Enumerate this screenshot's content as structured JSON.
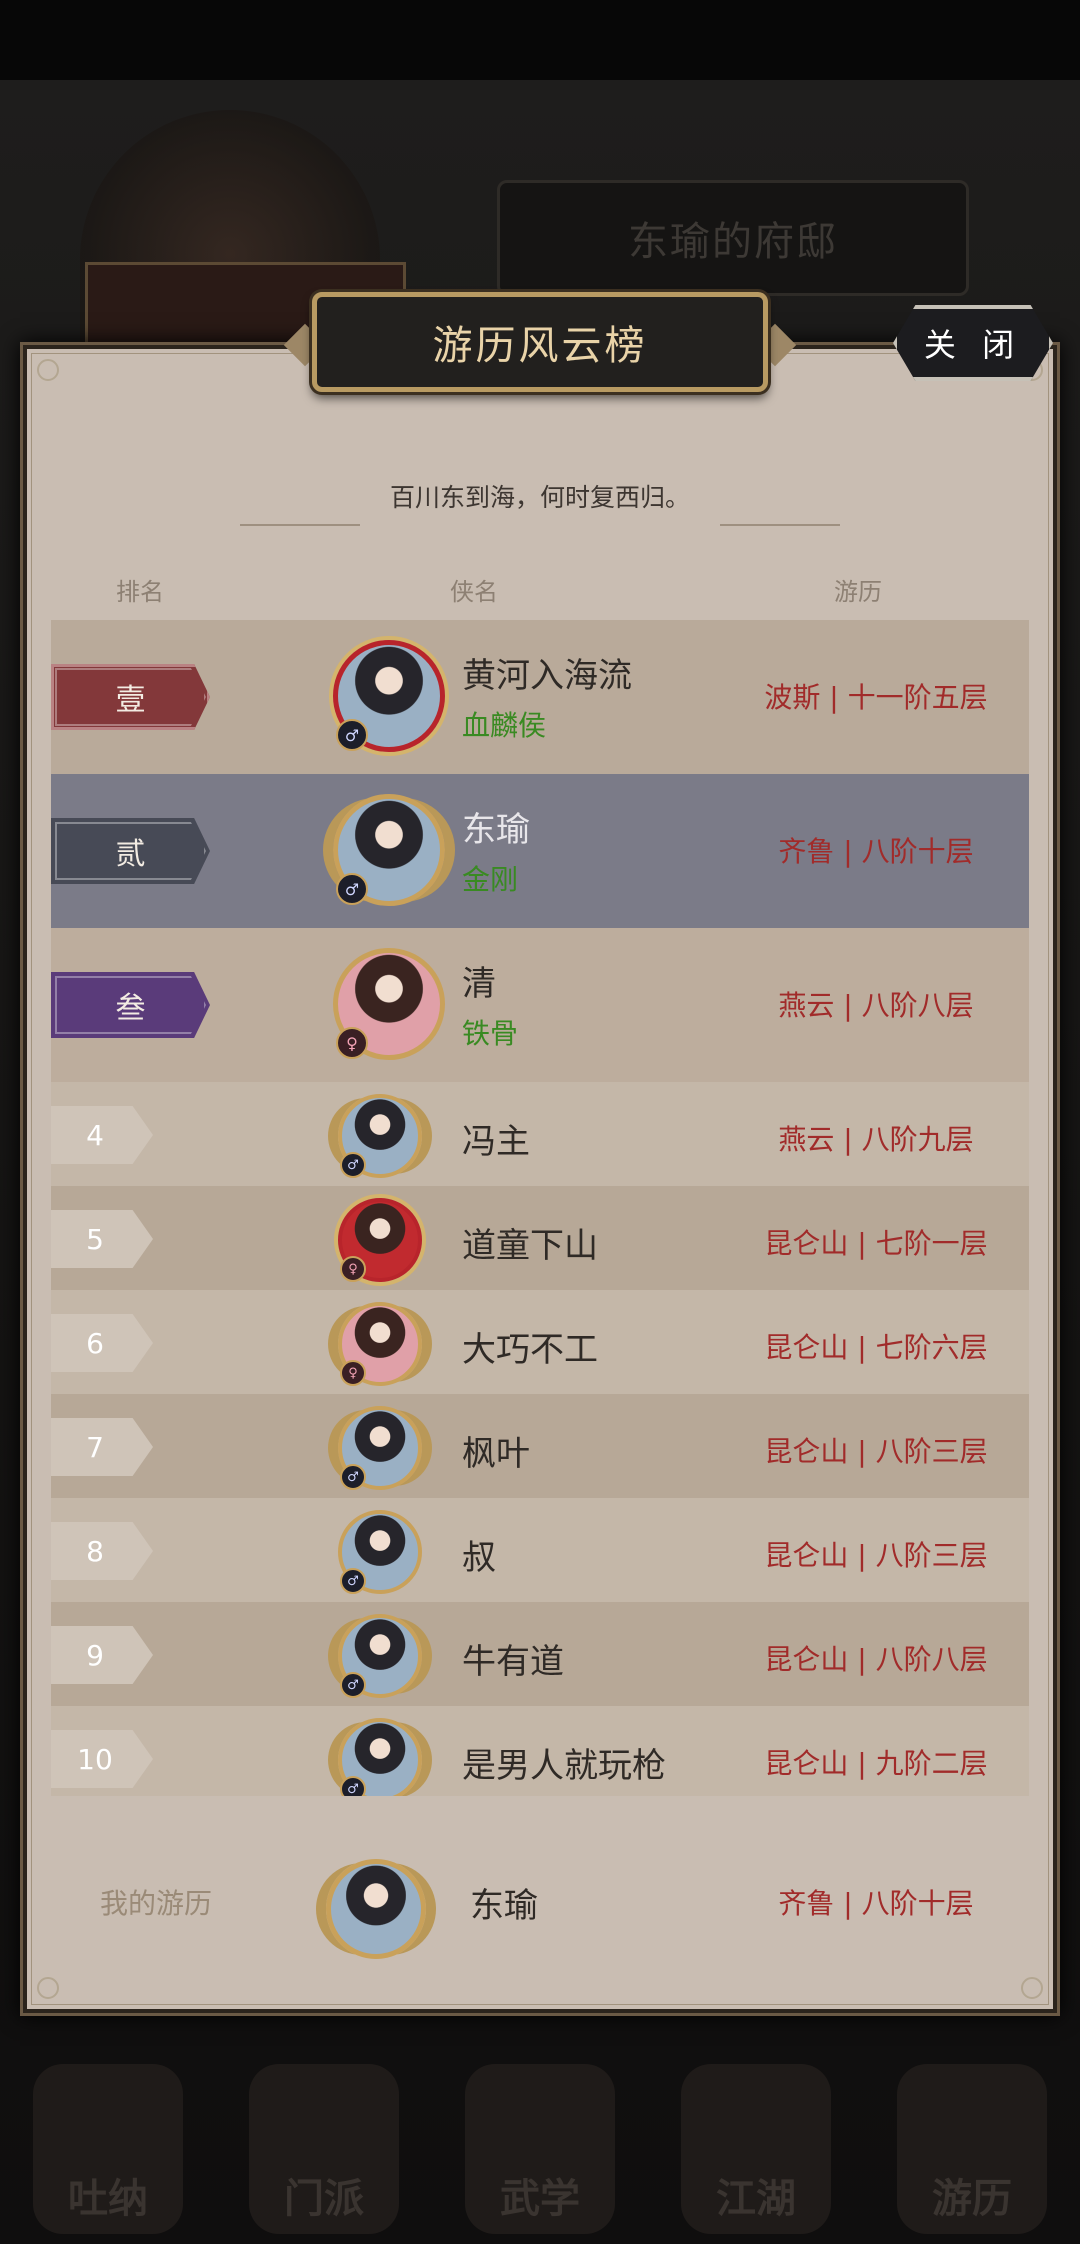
{
  "background": {
    "residence_label": "东瑜的府邸",
    "bottom_nav": [
      "吐纳",
      "门派",
      "武学",
      "江湖",
      "游历"
    ]
  },
  "panel": {
    "title": "游历风云榜",
    "close_label": "关 闭",
    "subtitle": "百川东到海，何时复西归。",
    "headers": {
      "rank": "排名",
      "name": "侠名",
      "progress": "游历"
    }
  },
  "rows": [
    {
      "rank": "壹",
      "name": "黄河入海流",
      "title": "血麟侯",
      "progress": "波斯 | 十一阶五层",
      "gender": "♂"
    },
    {
      "rank": "贰",
      "name": "东瑜",
      "title": "金刚",
      "progress": "齐鲁 | 八阶十层",
      "gender": "♂"
    },
    {
      "rank": "叁",
      "name": "清",
      "title": "铁骨",
      "progress": "燕云 | 八阶八层",
      "gender": "♀"
    },
    {
      "rank": "4",
      "name": "冯主",
      "progress": "燕云 | 八阶九层",
      "gender": "♂"
    },
    {
      "rank": "5",
      "name": "道童下山",
      "progress": "昆仑山 | 七阶一层",
      "gender": "♀"
    },
    {
      "rank": "6",
      "name": "大巧不工",
      "progress": "昆仑山 | 七阶六层",
      "gender": "♀"
    },
    {
      "rank": "7",
      "name": "枫叶",
      "progress": "昆仑山 | 八阶三层",
      "gender": "♂"
    },
    {
      "rank": "8",
      "name": "叔",
      "progress": "昆仑山 | 八阶三层",
      "gender": "♂"
    },
    {
      "rank": "9",
      "name": "牛有道",
      "progress": "昆仑山 | 八阶八层",
      "gender": "♂"
    },
    {
      "rank": "10",
      "name": "是男人就玩枪",
      "progress": "昆仑山 | 九阶二层",
      "gender": "♂"
    }
  ],
  "mine": {
    "label": "我的游历",
    "name": "东瑜",
    "progress": "齐鲁 | 八阶十层"
  }
}
